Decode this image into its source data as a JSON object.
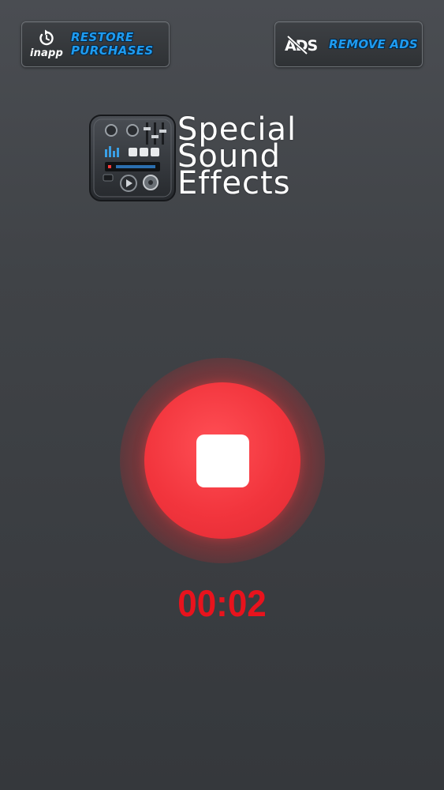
{
  "header": {
    "restore": {
      "icon": "inapp-icon",
      "icon_text": "inapp",
      "label_line1": "Restore",
      "label_line2": "Purchases"
    },
    "remove_ads": {
      "icon": "no-ads-icon",
      "label": "Remove ads"
    }
  },
  "logo": {
    "icon": "audio-mixer-icon",
    "title_line1": "Special",
    "title_line2": "Sound",
    "title_line3": "Effects"
  },
  "recorder": {
    "button_icon": "stop-icon",
    "timer": "00:02"
  },
  "colors": {
    "accent_blue": "#1e9bf0",
    "record_red": "#f2353d",
    "timer_red": "#e8131d",
    "background": "#404347"
  }
}
